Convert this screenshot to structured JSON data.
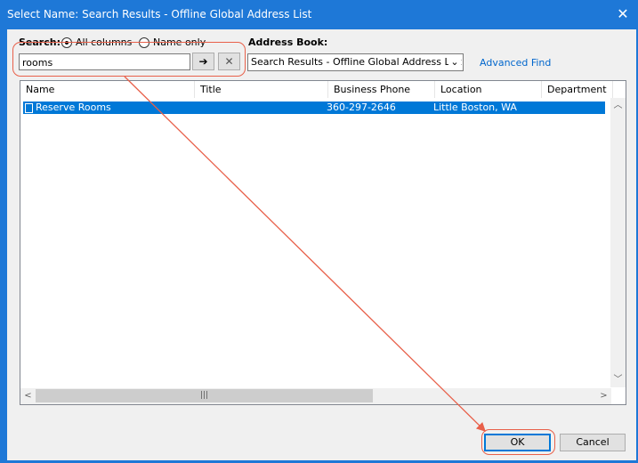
{
  "window": {
    "title": "Select Name: Search Results - Offline Global Address List",
    "close_glyph": "✕"
  },
  "search": {
    "label": "Search:",
    "all_columns_label": "All columns",
    "name_only_label": "Name only",
    "selected": "All columns",
    "value": "rooms",
    "go_glyph": "➔",
    "clear_glyph": "✕"
  },
  "address_book": {
    "label": "Address Book:",
    "selected": "Search Results - Offline Global Address List",
    "advanced_find": "Advanced Find"
  },
  "results": {
    "columns": [
      "Name",
      "Title",
      "Business Phone",
      "Location",
      "Department"
    ],
    "rows": [
      {
        "name": "Reserve Rooms",
        "title": "",
        "phone": "360-297-2646",
        "location": "Little Boston, WA",
        "department": ""
      }
    ],
    "selected_row": 0
  },
  "buttons": {
    "ok": "OK",
    "cancel": "Cancel"
  },
  "colors": {
    "accent": "#0078d7",
    "titlebar": "#1e78d7",
    "annotation": "#e8604a"
  }
}
